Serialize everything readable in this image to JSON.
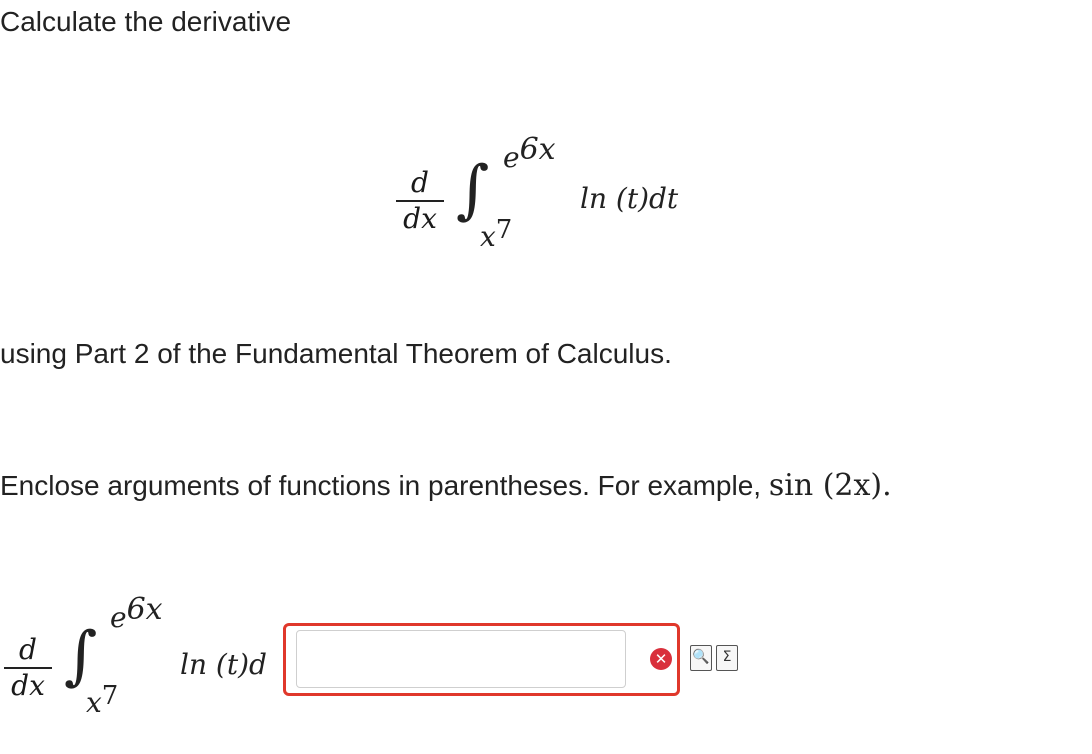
{
  "question": {
    "prompt": "Calculate the derivative",
    "theorem_text": "using Part 2 of the Fundamental Theorem of Calculus.",
    "instruction_prefix": "Enclose arguments of functions in parentheses. For example, ",
    "instruction_example": "sin (2x).",
    "expression": {
      "deriv_num": "d",
      "deriv_den": "dx",
      "integral_sign": "∫",
      "upper_limit": "e6x",
      "upper_limit_base": "e",
      "upper_limit_exp": "6x",
      "lower_limit_base": "x",
      "lower_limit_exp": "7",
      "integrand": "ln (t)dt"
    }
  },
  "answer": {
    "deriv_num": "d",
    "deriv_den": "dx",
    "integral_sign": "∫",
    "upper_limit_base": "e",
    "upper_limit_exp": "6x",
    "lower_limit_base": "x",
    "lower_limit_exp": "7",
    "integrand_prefix": "ln (t)d",
    "input_value": "",
    "state": "error"
  },
  "icons": {
    "error": "error-x-icon",
    "preview": "preview-icon",
    "equation_editor": "sigma-icon"
  },
  "colors": {
    "error_border": "#e0382b",
    "error_icon": "#d9303c"
  }
}
